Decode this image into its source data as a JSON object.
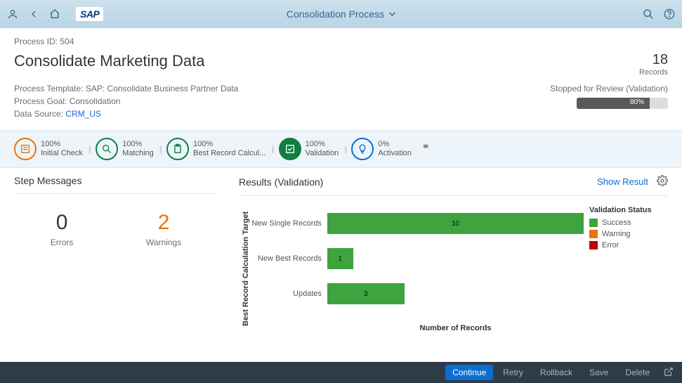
{
  "header": {
    "title": "Consolidation Process",
    "sap_logo": "SAP"
  },
  "info": {
    "process_id_label": "Process ID:",
    "process_id": "504",
    "page_title": "Consolidate Marketing Data",
    "records_num": "18",
    "records_label": "Records",
    "template_label": "Process Template:",
    "template_value": "SAP: Consolidate Business Partner Data",
    "goal_label": "Process Goal:",
    "goal_value": "Consolidation",
    "datasource_label": "Data Source:",
    "datasource_value": "CRM_US",
    "status": "Stopped for Review (Validation)",
    "progress_pct": "80%"
  },
  "train": {
    "steps": [
      {
        "pct": "100%",
        "label": "Initial Check"
      },
      {
        "pct": "100%",
        "label": "Matching"
      },
      {
        "pct": "100%",
        "label": "Best Record Calcul..."
      },
      {
        "pct": "100%",
        "label": "Validation"
      },
      {
        "pct": "0%",
        "label": "Activation"
      }
    ]
  },
  "messages": {
    "title": "Step Messages",
    "errors_num": "0",
    "errors_label": "Errors",
    "warnings_num": "2",
    "warnings_label": "Warnings"
  },
  "results": {
    "title": "Results (Validation)",
    "show_result": "Show Result",
    "legend_title": "Validation Status",
    "legend": [
      {
        "label": "Success",
        "color": "#3fa33f"
      },
      {
        "label": "Warning",
        "color": "#e9730c"
      },
      {
        "label": "Error",
        "color": "#bb0000"
      }
    ]
  },
  "chart_data": {
    "type": "bar",
    "orientation": "horizontal",
    "categories": [
      "New Single Records",
      "New Best Records",
      "Updates"
    ],
    "values": [
      10,
      1,
      3
    ],
    "title": "",
    "xlabel": "Number of Records",
    "ylabel": "Best Record Calculation Target",
    "xlim": [
      0,
      10
    ],
    "series_name": "Success",
    "color": "#3fa33f"
  },
  "footer": {
    "continue": "Continue",
    "retry": "Retry",
    "rollback": "Rollback",
    "save": "Save",
    "delete": "Delete"
  }
}
